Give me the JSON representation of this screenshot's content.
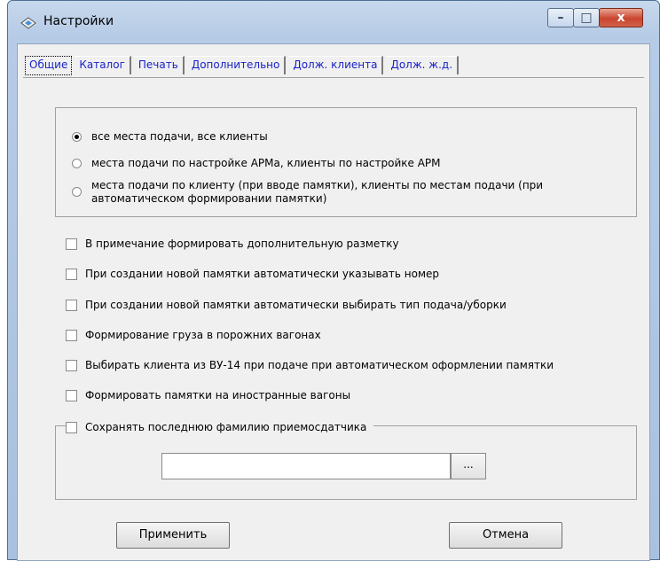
{
  "window": {
    "title": "Настройки",
    "controls": {
      "minimize": "–",
      "maximize": "□",
      "close": "x"
    }
  },
  "tabs": [
    {
      "label": "Общие",
      "active": true
    },
    {
      "label": "Каталог"
    },
    {
      "label": "Печать"
    },
    {
      "label": "Дополнительно"
    },
    {
      "label": "Долж. клиента"
    },
    {
      "label": "Долж. ж.д."
    }
  ],
  "radios": [
    {
      "label": "все места подачи, все клиенты",
      "selected": true
    },
    {
      "label": "места подачи по настройке АРМа, клиенты по настройке АРМ",
      "selected": false
    },
    {
      "label": "места подачи по клиенту (при вводе памятки), клиенты по местам подачи (при автоматическом формировании памятки)",
      "selected": false
    }
  ],
  "checkboxes": [
    {
      "label": "В примечание формировать дополнительную разметку",
      "checked": false
    },
    {
      "label": "При создании новой памятки автоматически указывать номер",
      "checked": false
    },
    {
      "label": "При создании новой памятки автоматически выбирать тип подача/уборки",
      "checked": false
    },
    {
      "label": "Формирование груза в порожних вагонах",
      "checked": false
    },
    {
      "label": "Выбирать клиента из ВУ-14 при подаче при автоматическом оформлении памятки",
      "checked": false
    },
    {
      "label": "Формировать памятки на иностранные вагоны",
      "checked": false
    }
  ],
  "save_surname": {
    "label": "Сохранять последнюю фамилию приемосдатчика",
    "checked": false,
    "value": "",
    "browse_label": "..."
  },
  "buttons": {
    "apply": "Применить",
    "cancel": "Отмена"
  },
  "colors": {
    "tab_text": "#1a22c8",
    "title_bar": "#b6cbe6",
    "close_button": "#c9452e"
  }
}
